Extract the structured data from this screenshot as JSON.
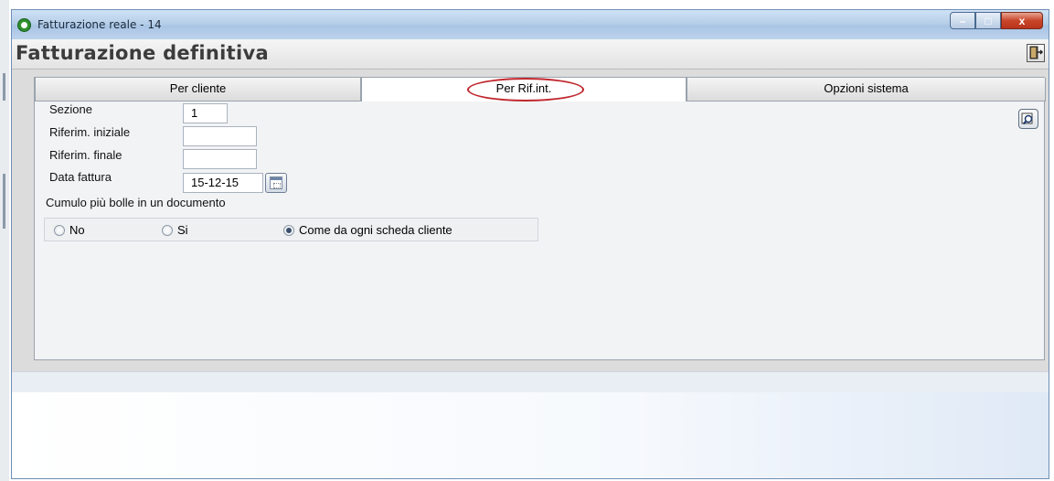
{
  "window": {
    "title": "Fatturazione reale - 14",
    "controls": {
      "minimize": "–",
      "maximize": "□",
      "close": "x"
    }
  },
  "header": {
    "title": "Fatturazione definitiva"
  },
  "tabs": [
    {
      "label": "Per cliente",
      "active": false
    },
    {
      "label": "Per Rif.int.",
      "active": true,
      "highlighted": true
    },
    {
      "label": "Opzioni sistema",
      "active": false
    }
  ],
  "form": {
    "sezione": {
      "label": "Sezione",
      "value": "1"
    },
    "rif_iniziale": {
      "label": "Riferim. iniziale",
      "value": ""
    },
    "rif_finale": {
      "label": "Riferim. finale",
      "value": ""
    },
    "data_fattura": {
      "label": "Data fattura",
      "value": "15-12-15"
    },
    "cumulo": {
      "label": "Cumulo più bolle in un documento",
      "options": [
        {
          "label": "No",
          "selected": false
        },
        {
          "label": "Si",
          "selected": false
        },
        {
          "label": "Come da ogni scheda cliente",
          "selected": true
        }
      ]
    }
  },
  "icons": {
    "app": "app-logo-icon",
    "exit": "exit-door-icon",
    "calendar": "calendar-icon",
    "search": "search-icon"
  },
  "colors": {
    "highlight_oval": "#c0262d",
    "titlebar": "#b7cfe9"
  }
}
